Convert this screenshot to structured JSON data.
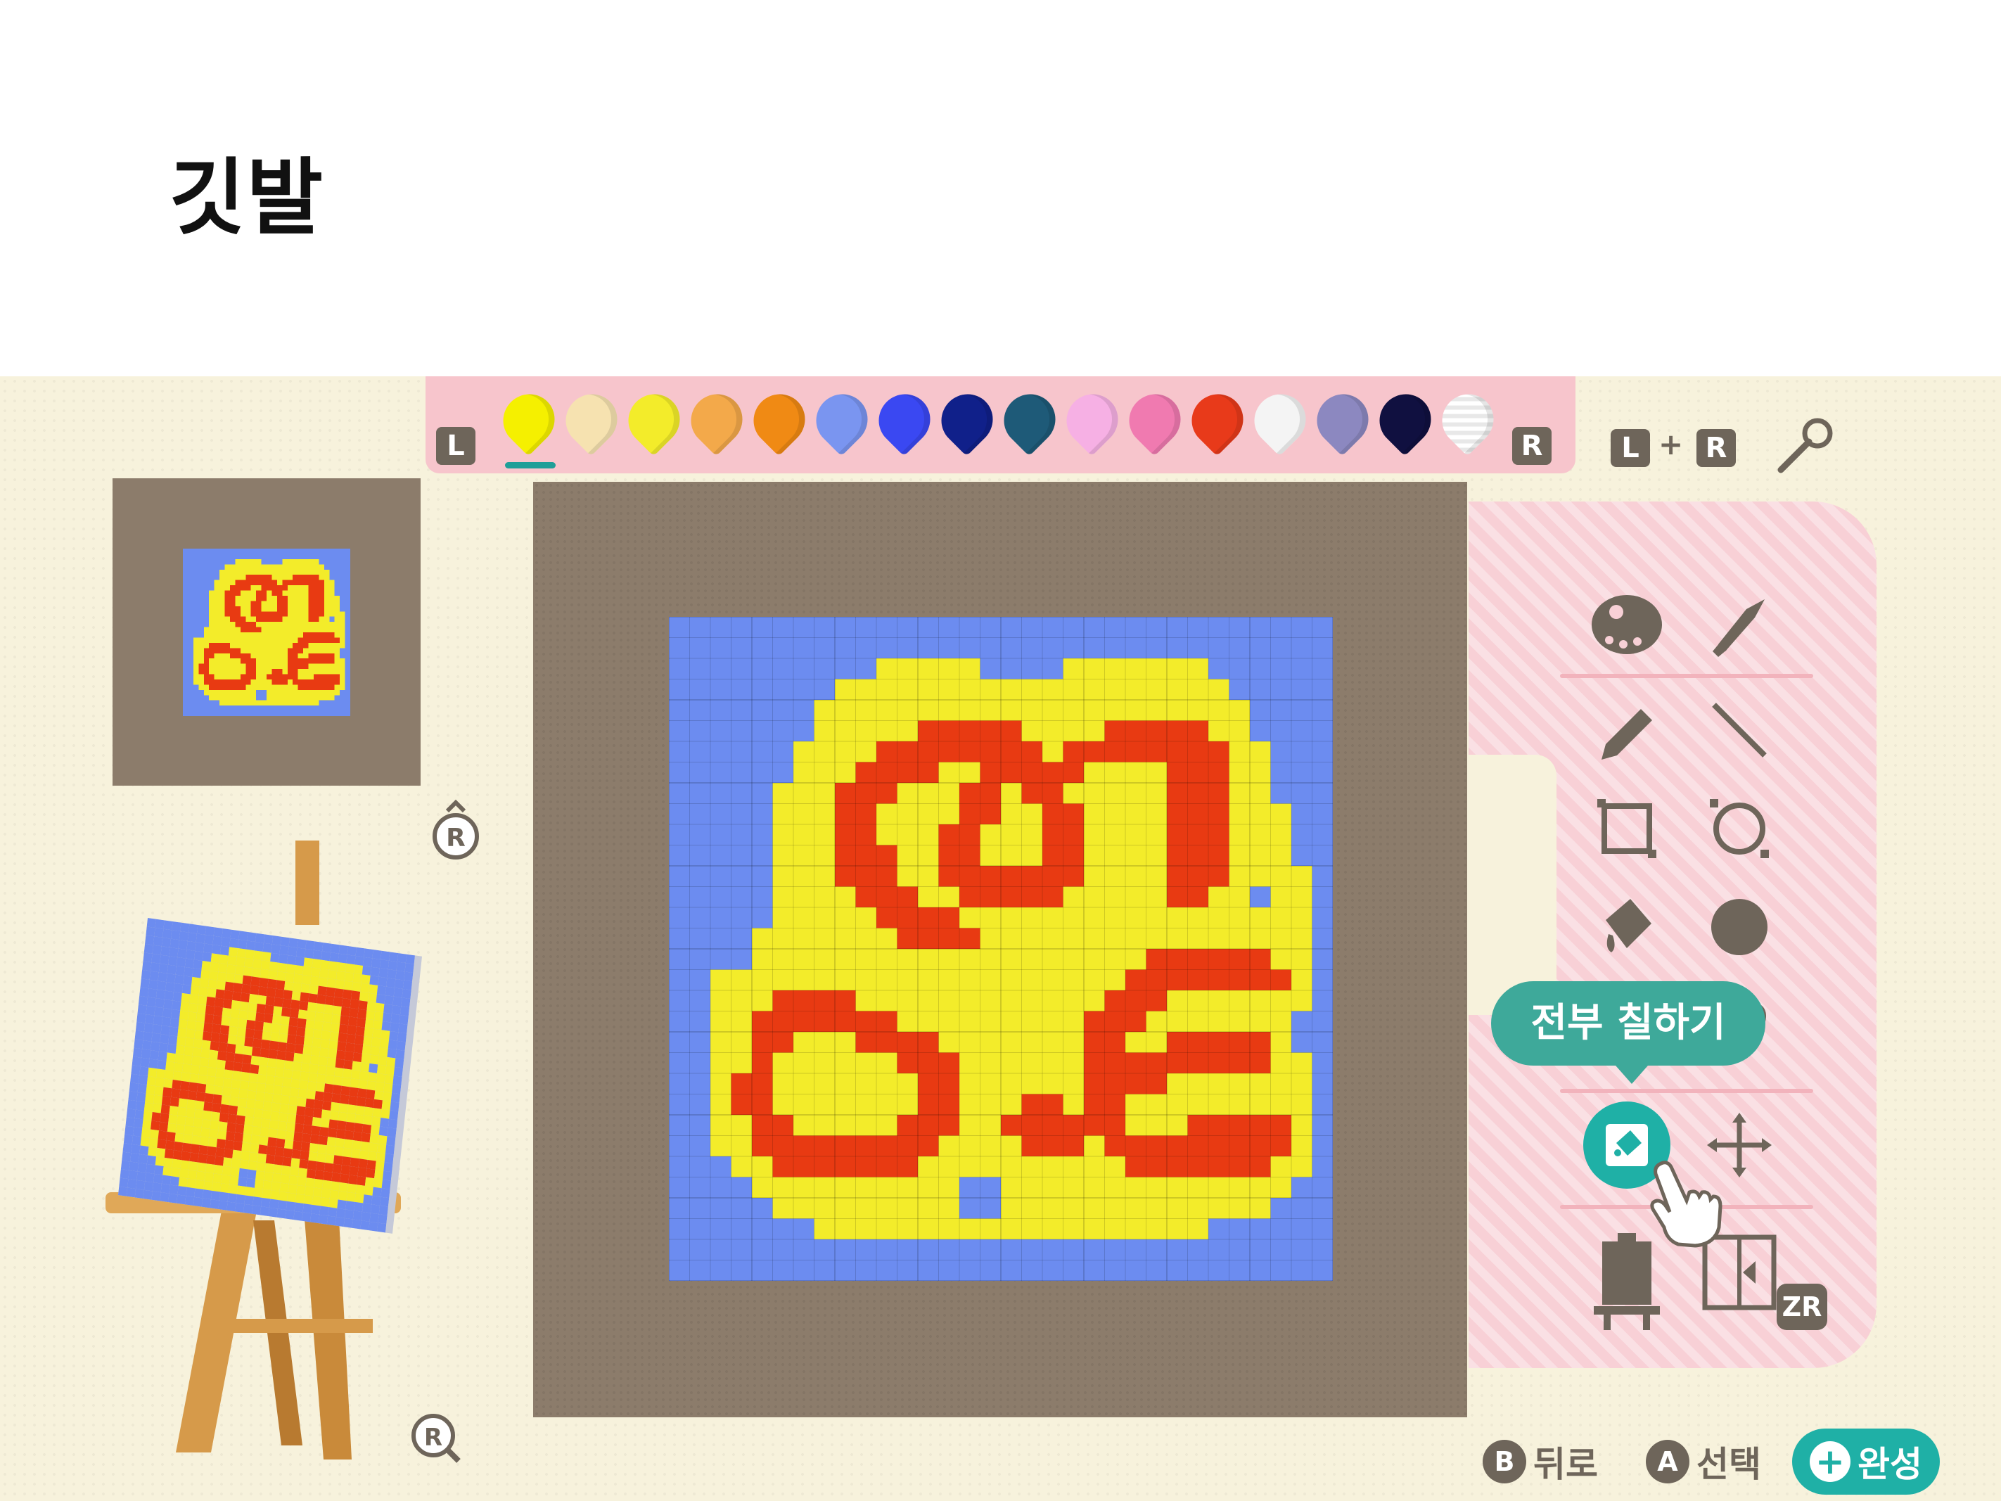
{
  "slide": {
    "title": "깃발"
  },
  "palette": {
    "left_button": "L",
    "right_button": "R",
    "lr_left": "L",
    "lr_plus": "+",
    "lr_right": "R",
    "colors": [
      "#f5f000",
      "#f6e2b0",
      "#f3ec2a",
      "#f3a94a",
      "#f08a14",
      "#7a95f0",
      "#3a48f2",
      "#10208a",
      "#1e5a78",
      "#f6b0e4",
      "#f07ab0",
      "#e83a1a",
      "#f4f4f4",
      "#8c88c0",
      "#101040",
      "#ffffff"
    ],
    "selected_index": 0
  },
  "pattern": {
    "grid_size": 32,
    "legend": {
      "B": "#6c8cf0",
      "Y": "#f3ec2a",
      "R": "#e83a12"
    },
    "rows": [
      "BBBBBBBBBBBBBBBBBBBBBBBBBBBBBBBB",
      "BBBBBBBBBBBBBBBBBBBBBBBBBBBBBBBB",
      "BBBBBBBBBBYYYYYBBBBYYYYYYYBBBBBB",
      "BBBBBBBBYYYYYYYYYYYYYYYYYYYBBBBB",
      "BBBBBBBYYYYYYYYYYYYYYYYYYYYYBBBB",
      "BBBBBBBYYYYYRRRRRYYYYRRRRRYYBBBB",
      "BBBBBBYYYYRRRRRRRRYRRRRRRRRYYBBB",
      "BBBBBBYYYRRRRYYRRRRRYYYYRRRYYBBB",
      "BBBBBYYYRRRYYYRRYRRYYYYYRRRYYBBB",
      "BBBBBYYYRRYYYYRRYYRRYYYYRRRYYYBB",
      "BBBBBYYYRRYYYRRYYYRRYYYYRRRYYYBB",
      "BBBBBYYYRRRYYRRYYYRRYYYYRRRYYYBB",
      "BBBBBYYYRRRYYRRRRRRRYYYYRRRYYYYB",
      "BBBBBYYYYRRRYYRRRRRYYYYYRRYYBYYB",
      "BBBBBYYYYYRRRRYYYYYYYYYYYYYYYYYB",
      "BBBBYYYYYYYRRRRYYYYYYYYYYYYYYYYB",
      "BBBBYYYYYYYYYYYYYYYYYYYRRRRRRYYB",
      "BBYYYYYYYYYYYYYYYYYYYYRRRRRRRRYB",
      "BBYYYRRRRYYYYYYYYYYYYRRRYYYYYYYB",
      "BBYYRRRRRRRYYYYYYYYYRRRYYYYYYYBB",
      "BBYYRRYYYRRRRYYYYYYYRRYYRRRRRYBB",
      "BBYYRYYYYYYRRRYYYYYYRRRRRRRRRYYB",
      "BBYRRYYYYYYYRRYYYYYYRRRRYYYYYYYB",
      "BBYRRYYYYYYYRRYYYRRYRRYYYYYYYYYB",
      "BBYYRRYYYYYRRRYYRRRRRRYYYRRRRRYB",
      "BBYYRRRRRRRRRYYYYRRRYRRRRRRRRRYB",
      "BBBYYRRRRRRRYYYYYYYYYYRRRRRRRYYB",
      "BBBBYYYYYYYYYYBBYYYYYYYYYYYYYYBB",
      "BBBBBYYYYYYYYYBBYYYYYYYYYYYYYBBB",
      "BBBBBBBYYYYYYYYYYYYYYYYYYYBBBBBB",
      "BBBBBBBBBBBBBBBBBBBBBBBBBBBBBBBB",
      "BBBBBBBBBBBBBBBBBBBBBBBBBBBBBBBB"
    ]
  },
  "tools": {
    "tooltip": "전부 칠하기",
    "zr_label": "ZR",
    "items": [
      "palette-icon",
      "paint-tube-icon",
      "pencil-icon",
      "line-icon",
      "rectangle-icon",
      "circle-icon",
      "paint-bucket-icon",
      "filled-circle-icon",
      "fill-all-icon",
      "move-icon",
      "easel-icon",
      "switch-layer-icon"
    ]
  },
  "controls": {
    "rotate_key": "R",
    "zoom_key": "R",
    "back_key": "B",
    "back_label": "뒤로",
    "select_key": "A",
    "select_label": "선택",
    "finish_key": "+",
    "finish_label": "완성"
  }
}
